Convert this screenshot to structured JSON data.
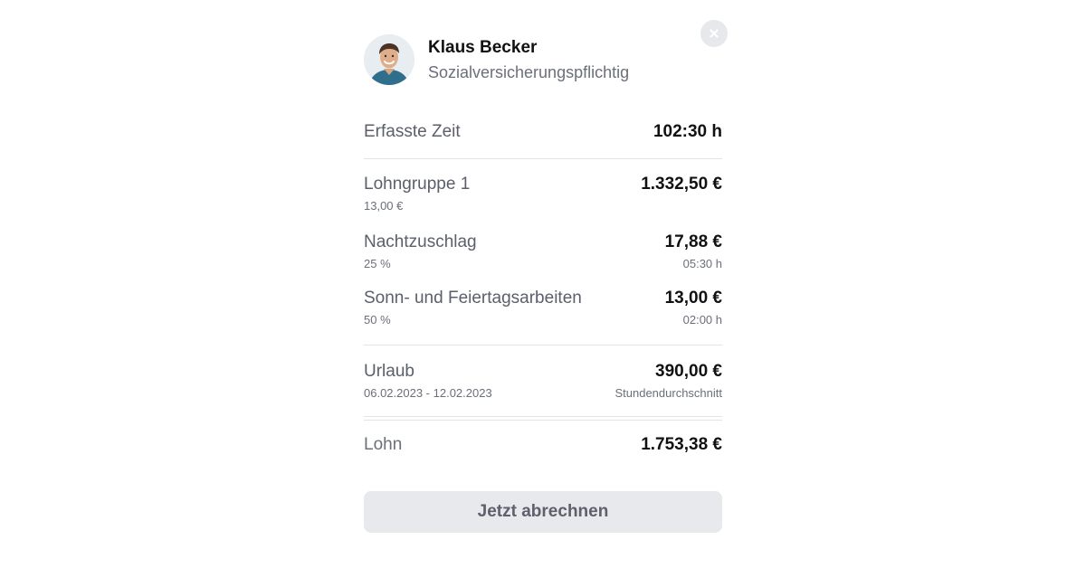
{
  "employee": {
    "name": "Klaus Becker",
    "status": "Sozialversicherungspflichtig"
  },
  "recorded_time": {
    "label": "Erfasste Zeit",
    "value": "102:30 h"
  },
  "items": [
    {
      "label": "Lohngruppe 1",
      "sub": "13,00 €",
      "value": "1.332,50 €",
      "sub_value": ""
    },
    {
      "label": "Nachtzuschlag",
      "sub": "25 %",
      "value": "17,88 €",
      "sub_value": "05:30 h"
    },
    {
      "label": "Sonn- und Feiertagsarbeiten",
      "sub": "50 %",
      "value": "13,00 €",
      "sub_value": "02:00 h"
    }
  ],
  "vacation": {
    "label": "Urlaub",
    "period": "06.02.2023 - 12.02.2023",
    "value": "390,00 €",
    "basis": "Stundendurchschnitt"
  },
  "total": {
    "label": "Lohn",
    "value": "1.753,38 €"
  },
  "action": {
    "label": "Jetzt abrechnen"
  },
  "colors": {
    "accent_text": "#111111",
    "muted_text": "#6b6f7a",
    "button_bg": "#e8e9ec",
    "divider": "#e2e4e8"
  },
  "icons": {
    "close": "close-icon",
    "avatar": "avatar-photo"
  }
}
